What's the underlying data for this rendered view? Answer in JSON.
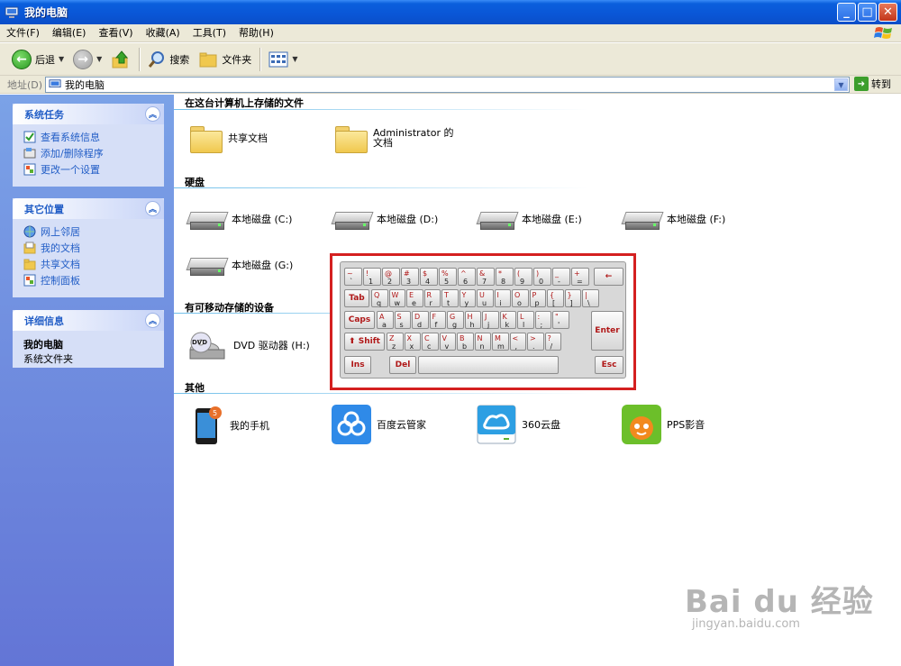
{
  "window": {
    "title": "我的电脑",
    "controls": [
      "minimize",
      "maximize",
      "close"
    ]
  },
  "menubar": [
    "文件(F)",
    "编辑(E)",
    "查看(V)",
    "收藏(A)",
    "工具(T)",
    "帮助(H)"
  ],
  "toolbar": {
    "back_label": "后退",
    "search_label": "搜索",
    "folders_label": "文件夹"
  },
  "address": {
    "label": "地址(D)",
    "value": "我的电脑",
    "go_label": "转到"
  },
  "sidebar": {
    "system_tasks": {
      "title": "系统任务",
      "items": [
        "查看系统信息",
        "添加/删除程序",
        "更改一个设置"
      ]
    },
    "other_places": {
      "title": "其它位置",
      "items": [
        "网上邻居",
        "我的文档",
        "共享文档",
        "控制面板"
      ]
    },
    "details": {
      "title": "详细信息",
      "name": "我的电脑",
      "type": "系统文件夹"
    }
  },
  "content": {
    "stored_files": {
      "heading": "在这台计算机上存储的文件",
      "items": [
        "共享文档",
        "Administrator 的文档"
      ]
    },
    "hard_drives": {
      "heading": "硬盘",
      "items": [
        "本地磁盘 (C:)",
        "本地磁盘 (D:)",
        "本地磁盘 (E:)",
        "本地磁盘 (F:)",
        "本地磁盘 (G:)"
      ]
    },
    "removable": {
      "heading": "有可移动存储的设备",
      "items": [
        "DVD 驱动器 (H:)"
      ]
    },
    "other": {
      "heading": "其他",
      "items": [
        "我的手机",
        "百度云管家",
        "360云盘",
        "PPS影音"
      ]
    }
  },
  "keyboard": {
    "row1": [
      [
        "~",
        "`"
      ],
      [
        "!",
        "1"
      ],
      [
        "@",
        "2"
      ],
      [
        "#",
        "3"
      ],
      [
        "$",
        "4"
      ],
      [
        "%",
        "5"
      ],
      [
        "^",
        "6"
      ],
      [
        "&",
        "7"
      ],
      [
        "*",
        "8"
      ],
      [
        "(",
        "9"
      ],
      [
        ")",
        "0"
      ],
      [
        "_",
        "-"
      ],
      [
        "+",
        "="
      ]
    ],
    "row2": [
      [
        "Q",
        "q"
      ],
      [
        "W",
        "w"
      ],
      [
        "E",
        "e"
      ],
      [
        "R",
        "r"
      ],
      [
        "T",
        "t"
      ],
      [
        "Y",
        "y"
      ],
      [
        "U",
        "u"
      ],
      [
        "I",
        "i"
      ],
      [
        "O",
        "o"
      ],
      [
        "P",
        "p"
      ],
      [
        "{",
        "["
      ],
      [
        "}",
        "]"
      ],
      [
        "|",
        "\\"
      ]
    ],
    "row3": [
      [
        "A",
        "a"
      ],
      [
        "S",
        "s"
      ],
      [
        "D",
        "d"
      ],
      [
        "F",
        "f"
      ],
      [
        "G",
        "g"
      ],
      [
        "H",
        "h"
      ],
      [
        "J",
        "j"
      ],
      [
        "K",
        "k"
      ],
      [
        "L",
        "l"
      ],
      [
        ":",
        ";"
      ],
      [
        "\"",
        "'"
      ]
    ],
    "row4": [
      [
        "Z",
        "z"
      ],
      [
        "X",
        "x"
      ],
      [
        "C",
        "c"
      ],
      [
        "V",
        "v"
      ],
      [
        "B",
        "b"
      ],
      [
        "N",
        "n"
      ],
      [
        "M",
        "m"
      ],
      [
        "<",
        ","
      ],
      [
        ">",
        "."
      ],
      [
        "?",
        "/"
      ]
    ],
    "tab": "Tab",
    "caps": "Caps",
    "shift": "Shift",
    "enter": "Enter",
    "ins": "Ins",
    "del": "Del",
    "esc": "Esc",
    "backspace": "←"
  },
  "watermark": {
    "main": "Bai du 经验",
    "sub": "jingyan.baidu.com"
  }
}
